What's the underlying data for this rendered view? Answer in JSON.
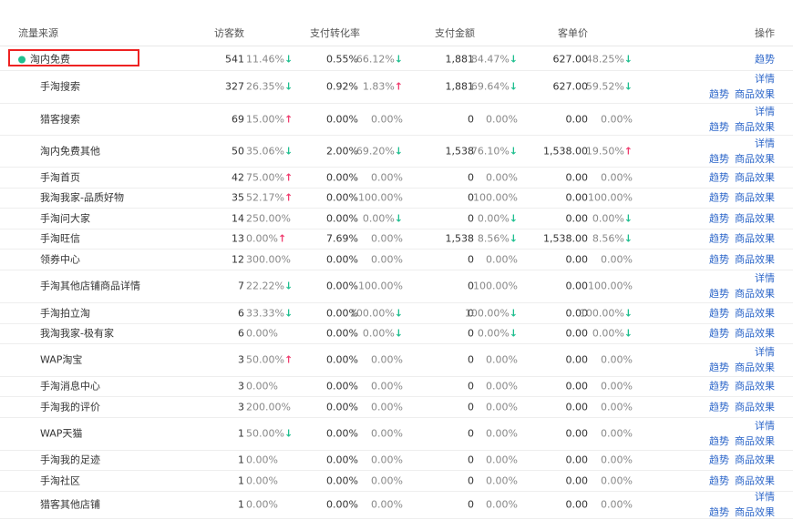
{
  "headers": {
    "source": "流量来源",
    "visitors": "访客数",
    "conv": "支付转化率",
    "amount": "支付金额",
    "unit_price": "客单价",
    "ops": "操作"
  },
  "ops_labels": {
    "trend": "趋势",
    "detail": "详情",
    "product": "商品效果"
  },
  "rows": [
    {
      "src": "淘内免费",
      "v": "541",
      "vp": "11.46%",
      "vt": "down",
      "c": "0.55%",
      "cp": "66.12%",
      "ct": "down",
      "a": "1,881",
      "ap": "84.47%",
      "at": "down",
      "u": "627.00",
      "up": "48.25%",
      "ut": "down",
      "ops": "trend"
    },
    {
      "src": "手淘搜索",
      "v": "327",
      "vp": "26.35%",
      "vt": "down",
      "c": "0.92%",
      "cp": "1.83%",
      "ct": "up",
      "a": "1,881",
      "ap": "69.64%",
      "at": "down",
      "u": "627.00",
      "up": "59.52%",
      "ut": "down",
      "ops": "full"
    },
    {
      "src": "猎客搜索",
      "v": "69",
      "vp": "15.00%",
      "vt": "up",
      "c": "0.00%",
      "cp": "0.00%",
      "ct": "",
      "a": "0",
      "ap": "0.00%",
      "at": "",
      "u": "0.00",
      "up": "0.00%",
      "ut": "",
      "ops": "full"
    },
    {
      "src": "淘内免费其他",
      "v": "50",
      "vp": "35.06%",
      "vt": "down",
      "c": "2.00%",
      "cp": "69.20%",
      "ct": "down",
      "a": "1,538",
      "ap": "76.10%",
      "at": "down",
      "u": "1,538.00",
      "up": "19.50%",
      "ut": "up",
      "ops": "full"
    },
    {
      "src": "手淘首页",
      "v": "42",
      "vp": "75.00%",
      "vt": "up",
      "c": "0.00%",
      "cp": "0.00%",
      "ct": "",
      "a": "0",
      "ap": "0.00%",
      "at": "",
      "u": "0.00",
      "up": "0.00%",
      "ut": "",
      "ops": "short"
    },
    {
      "src": "我淘我家-品质好物",
      "v": "35",
      "vp": "52.17%",
      "vt": "up",
      "c": "0.00%",
      "cp": "100.00%",
      "ct": "",
      "a": "0",
      "ap": "100.00%",
      "at": "",
      "u": "0.00",
      "up": "100.00%",
      "ut": "",
      "ops": "short"
    },
    {
      "src": "手淘问大家",
      "v": "14",
      "vp": "250.00%",
      "vt": "",
      "c": "0.00%",
      "cp": "0.00%",
      "ct": "down",
      "a": "0",
      "ap": "0.00%",
      "at": "down",
      "u": "0.00",
      "up": "0.00%",
      "ut": "down",
      "ops": "short"
    },
    {
      "src": "手淘旺信",
      "v": "13",
      "vp": "0.00%",
      "vt": "up",
      "c": "7.69%",
      "cp": "0.00%",
      "ct": "",
      "a": "1,538",
      "ap": "8.56%",
      "at": "down",
      "u": "1,538.00",
      "up": "8.56%",
      "ut": "down",
      "ops": "short"
    },
    {
      "src": "领券中心",
      "v": "12",
      "vp": "300.00%",
      "vt": "",
      "c": "0.00%",
      "cp": "0.00%",
      "ct": "",
      "a": "0",
      "ap": "0.00%",
      "at": "",
      "u": "0.00",
      "up": "0.00%",
      "ut": "",
      "ops": "short"
    },
    {
      "src": "手淘其他店铺商品详情",
      "v": "7",
      "vp": "22.22%",
      "vt": "updown",
      "c": "0.00%",
      "cp": "100.00%",
      "ct": "",
      "a": "0",
      "ap": "100.00%",
      "at": "",
      "u": "0.00",
      "up": "100.00%",
      "ut": "",
      "ops": "full"
    },
    {
      "src": "手淘拍立淘",
      "v": "6",
      "vp": "33.33%",
      "vt": "down",
      "c": "0.00%",
      "cp": "100.00%",
      "ct": "down",
      "a": "0",
      "ap": "100.00%",
      "at": "down",
      "u": "0.00",
      "up": "100.00%",
      "ut": "down",
      "ops": "short"
    },
    {
      "src": "我淘我家-极有家",
      "v": "6",
      "vp": "0.00%",
      "vt": "",
      "c": "0.00%",
      "cp": "0.00%",
      "ct": "down",
      "a": "0",
      "ap": "0.00%",
      "at": "down",
      "u": "0.00",
      "up": "0.00%",
      "ut": "down",
      "ops": "short"
    },
    {
      "src": "WAP淘宝",
      "v": "3",
      "vp": "50.00%",
      "vt": "up",
      "c": "0.00%",
      "cp": "0.00%",
      "ct": "",
      "a": "0",
      "ap": "0.00%",
      "at": "",
      "u": "0.00",
      "up": "0.00%",
      "ut": "",
      "ops": "full"
    },
    {
      "src": "手淘消息中心",
      "v": "3",
      "vp": "0.00%",
      "vt": "",
      "c": "0.00%",
      "cp": "0.00%",
      "ct": "",
      "a": "0",
      "ap": "0.00%",
      "at": "",
      "u": "0.00",
      "up": "0.00%",
      "ut": "",
      "ops": "short"
    },
    {
      "src": "手淘我的评价",
      "v": "3",
      "vp": "200.00%",
      "vt": "",
      "c": "0.00%",
      "cp": "0.00%",
      "ct": "",
      "a": "0",
      "ap": "0.00%",
      "at": "",
      "u": "0.00",
      "up": "0.00%",
      "ut": "",
      "ops": "short"
    },
    {
      "src": "WAP天猫",
      "v": "1",
      "vp": "50.00%",
      "vt": "updown",
      "c": "0.00%",
      "cp": "0.00%",
      "ct": "",
      "a": "0",
      "ap": "0.00%",
      "at": "",
      "u": "0.00",
      "up": "0.00%",
      "ut": "",
      "ops": "full"
    },
    {
      "src": "手淘我的足迹",
      "v": "1",
      "vp": "0.00%",
      "vt": "",
      "c": "0.00%",
      "cp": "0.00%",
      "ct": "",
      "a": "0",
      "ap": "0.00%",
      "at": "",
      "u": "0.00",
      "up": "0.00%",
      "ut": "",
      "ops": "short"
    },
    {
      "src": "手淘社区",
      "v": "1",
      "vp": "0.00%",
      "vt": "",
      "c": "0.00%",
      "cp": "0.00%",
      "ct": "",
      "a": "0",
      "ap": "0.00%",
      "at": "",
      "u": "0.00",
      "up": "0.00%",
      "ut": "",
      "ops": "short"
    },
    {
      "src": "猎客其他店铺",
      "v": "1",
      "vp": "0.00%",
      "vt": "",
      "c": "0.00%",
      "cp": "0.00%",
      "ct": "",
      "a": "0",
      "ap": "0.00%",
      "at": "",
      "u": "0.00",
      "up": "0.00%",
      "ut": "",
      "ops": "full"
    }
  ],
  "colors": {
    "up": "#f03c6e",
    "down": "#1fbf8f",
    "link": "#2c66c9",
    "highlight": "#e22222"
  },
  "icons": {
    "up": "arrow-up-icon",
    "down": "arrow-down-icon",
    "bullet": "dot-icon"
  }
}
